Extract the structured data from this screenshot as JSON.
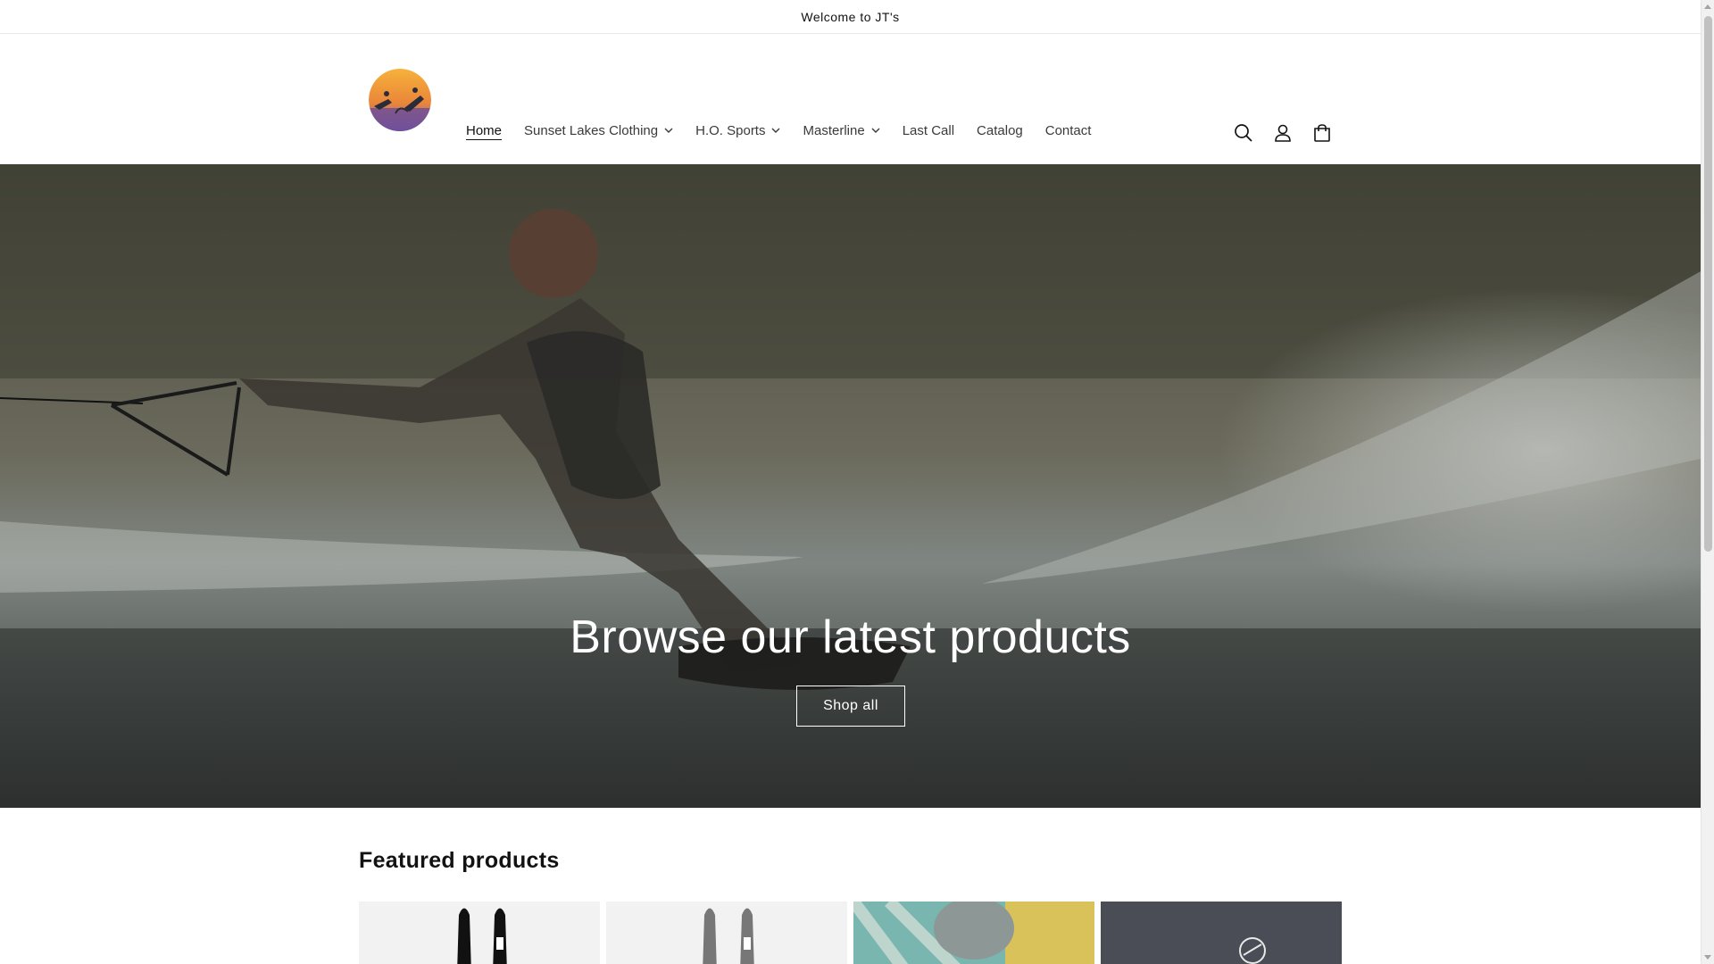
{
  "announcement": {
    "text": "Welcome to JT's"
  },
  "header": {
    "logo_name": "JT's logo",
    "nav": [
      {
        "label": "Home",
        "active": true,
        "dropdown": false
      },
      {
        "label": "Sunset Lakes Clothing",
        "active": false,
        "dropdown": true
      },
      {
        "label": "H.O. Sports",
        "active": false,
        "dropdown": true
      },
      {
        "label": "Masterline",
        "active": false,
        "dropdown": true
      },
      {
        "label": "Last Call",
        "active": false,
        "dropdown": false
      },
      {
        "label": "Catalog",
        "active": false,
        "dropdown": false
      },
      {
        "label": "Contact",
        "active": false,
        "dropdown": false
      }
    ],
    "icons": [
      "search-icon",
      "account-icon",
      "cart-icon"
    ]
  },
  "hero": {
    "title": "Browse our latest products",
    "button": "Shop all"
  },
  "featured": {
    "title": "Featured products",
    "cards": [
      "water-ski-product",
      "water-ski-product",
      "swim-cap-product",
      "t-shirt-product"
    ]
  },
  "colors": {
    "text": "#121212",
    "hero_overlay": "#3f4038",
    "button_border": "#ffffff"
  }
}
